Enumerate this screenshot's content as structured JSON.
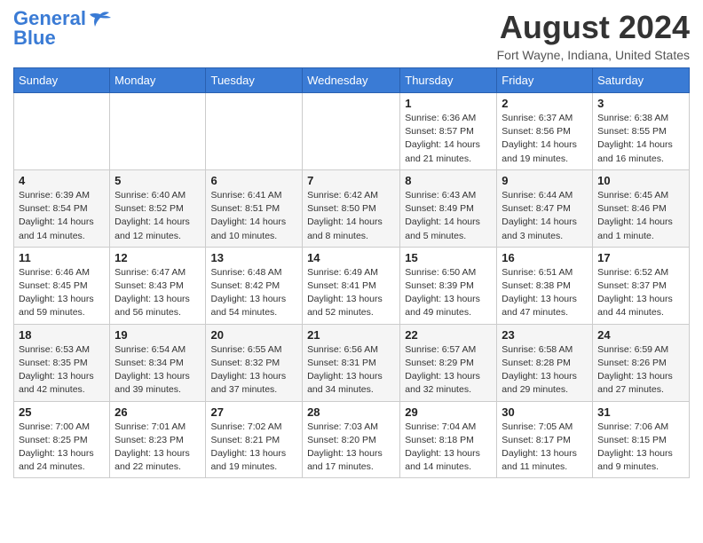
{
  "logo": {
    "line1": "General",
    "line2": "Blue"
  },
  "title": "August 2024",
  "subtitle": "Fort Wayne, Indiana, United States",
  "days_header": [
    "Sunday",
    "Monday",
    "Tuesday",
    "Wednesday",
    "Thursday",
    "Friday",
    "Saturday"
  ],
  "weeks": [
    [
      {
        "day": "",
        "info": ""
      },
      {
        "day": "",
        "info": ""
      },
      {
        "day": "",
        "info": ""
      },
      {
        "day": "",
        "info": ""
      },
      {
        "day": "1",
        "info": "Sunrise: 6:36 AM\nSunset: 8:57 PM\nDaylight: 14 hours and 21 minutes."
      },
      {
        "day": "2",
        "info": "Sunrise: 6:37 AM\nSunset: 8:56 PM\nDaylight: 14 hours and 19 minutes."
      },
      {
        "day": "3",
        "info": "Sunrise: 6:38 AM\nSunset: 8:55 PM\nDaylight: 14 hours and 16 minutes."
      }
    ],
    [
      {
        "day": "4",
        "info": "Sunrise: 6:39 AM\nSunset: 8:54 PM\nDaylight: 14 hours and 14 minutes."
      },
      {
        "day": "5",
        "info": "Sunrise: 6:40 AM\nSunset: 8:52 PM\nDaylight: 14 hours and 12 minutes."
      },
      {
        "day": "6",
        "info": "Sunrise: 6:41 AM\nSunset: 8:51 PM\nDaylight: 14 hours and 10 minutes."
      },
      {
        "day": "7",
        "info": "Sunrise: 6:42 AM\nSunset: 8:50 PM\nDaylight: 14 hours and 8 minutes."
      },
      {
        "day": "8",
        "info": "Sunrise: 6:43 AM\nSunset: 8:49 PM\nDaylight: 14 hours and 5 minutes."
      },
      {
        "day": "9",
        "info": "Sunrise: 6:44 AM\nSunset: 8:47 PM\nDaylight: 14 hours and 3 minutes."
      },
      {
        "day": "10",
        "info": "Sunrise: 6:45 AM\nSunset: 8:46 PM\nDaylight: 14 hours and 1 minute."
      }
    ],
    [
      {
        "day": "11",
        "info": "Sunrise: 6:46 AM\nSunset: 8:45 PM\nDaylight: 13 hours and 59 minutes."
      },
      {
        "day": "12",
        "info": "Sunrise: 6:47 AM\nSunset: 8:43 PM\nDaylight: 13 hours and 56 minutes."
      },
      {
        "day": "13",
        "info": "Sunrise: 6:48 AM\nSunset: 8:42 PM\nDaylight: 13 hours and 54 minutes."
      },
      {
        "day": "14",
        "info": "Sunrise: 6:49 AM\nSunset: 8:41 PM\nDaylight: 13 hours and 52 minutes."
      },
      {
        "day": "15",
        "info": "Sunrise: 6:50 AM\nSunset: 8:39 PM\nDaylight: 13 hours and 49 minutes."
      },
      {
        "day": "16",
        "info": "Sunrise: 6:51 AM\nSunset: 8:38 PM\nDaylight: 13 hours and 47 minutes."
      },
      {
        "day": "17",
        "info": "Sunrise: 6:52 AM\nSunset: 8:37 PM\nDaylight: 13 hours and 44 minutes."
      }
    ],
    [
      {
        "day": "18",
        "info": "Sunrise: 6:53 AM\nSunset: 8:35 PM\nDaylight: 13 hours and 42 minutes."
      },
      {
        "day": "19",
        "info": "Sunrise: 6:54 AM\nSunset: 8:34 PM\nDaylight: 13 hours and 39 minutes."
      },
      {
        "day": "20",
        "info": "Sunrise: 6:55 AM\nSunset: 8:32 PM\nDaylight: 13 hours and 37 minutes."
      },
      {
        "day": "21",
        "info": "Sunrise: 6:56 AM\nSunset: 8:31 PM\nDaylight: 13 hours and 34 minutes."
      },
      {
        "day": "22",
        "info": "Sunrise: 6:57 AM\nSunset: 8:29 PM\nDaylight: 13 hours and 32 minutes."
      },
      {
        "day": "23",
        "info": "Sunrise: 6:58 AM\nSunset: 8:28 PM\nDaylight: 13 hours and 29 minutes."
      },
      {
        "day": "24",
        "info": "Sunrise: 6:59 AM\nSunset: 8:26 PM\nDaylight: 13 hours and 27 minutes."
      }
    ],
    [
      {
        "day": "25",
        "info": "Sunrise: 7:00 AM\nSunset: 8:25 PM\nDaylight: 13 hours and 24 minutes."
      },
      {
        "day": "26",
        "info": "Sunrise: 7:01 AM\nSunset: 8:23 PM\nDaylight: 13 hours and 22 minutes."
      },
      {
        "day": "27",
        "info": "Sunrise: 7:02 AM\nSunset: 8:21 PM\nDaylight: 13 hours and 19 minutes."
      },
      {
        "day": "28",
        "info": "Sunrise: 7:03 AM\nSunset: 8:20 PM\nDaylight: 13 hours and 17 minutes."
      },
      {
        "day": "29",
        "info": "Sunrise: 7:04 AM\nSunset: 8:18 PM\nDaylight: 13 hours and 14 minutes."
      },
      {
        "day": "30",
        "info": "Sunrise: 7:05 AM\nSunset: 8:17 PM\nDaylight: 13 hours and 11 minutes."
      },
      {
        "day": "31",
        "info": "Sunrise: 7:06 AM\nSunset: 8:15 PM\nDaylight: 13 hours and 9 minutes."
      }
    ]
  ]
}
